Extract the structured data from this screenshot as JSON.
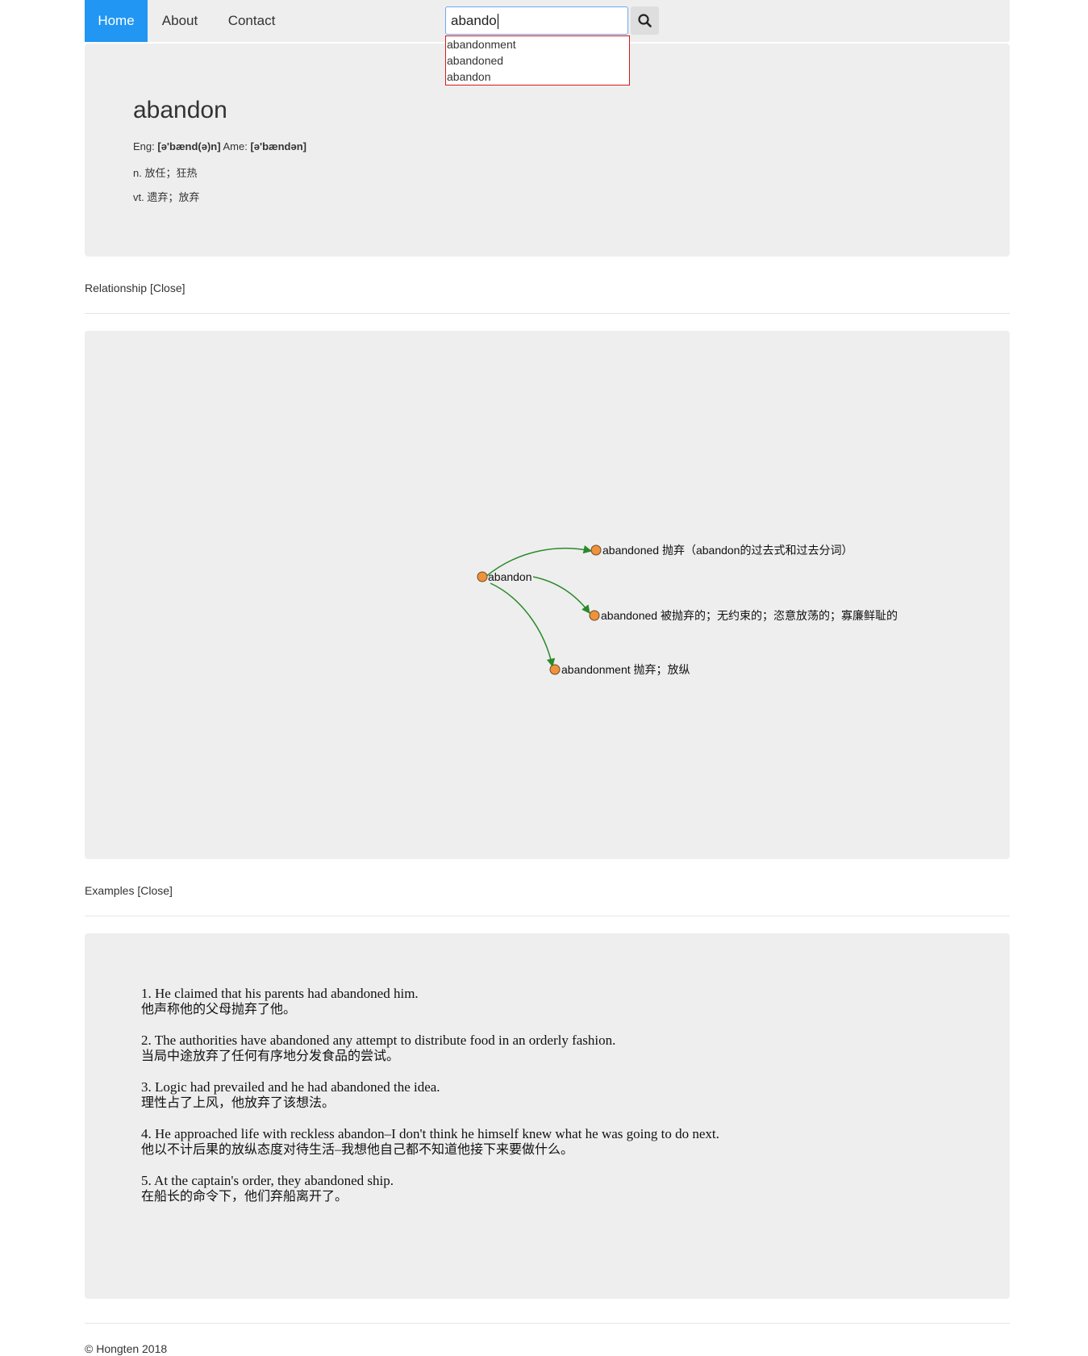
{
  "nav": {
    "home": "Home",
    "about": "About",
    "contact": "Contact"
  },
  "search": {
    "value": "abando",
    "icon": "search-icon",
    "suggestions": [
      "abandonment",
      "abandoned",
      "abandon"
    ]
  },
  "word": {
    "title": "abandon",
    "eng_label": "Eng:",
    "eng_phonetic": "[ə'bænd(ə)n]",
    "ame_label": "Ame:",
    "ame_phonetic": "[ə'bændən]",
    "definitions": [
      "n. 放任；狂热",
      "vt. 遗弃；放弃"
    ]
  },
  "relationship": {
    "heading": "Relationship [Close]",
    "nodes": [
      {
        "label": "abandon"
      },
      {
        "label": "abandoned 抛弃（abandon的过去式和过去分词）"
      },
      {
        "label": "abandoned 被抛弃的；无约束的；恣意放荡的；寡廉鲜耻的"
      },
      {
        "label": "abandonment 抛弃；放纵"
      }
    ],
    "colors": {
      "node": "#f0923a",
      "edge": "#2a8a2a"
    }
  },
  "examples": {
    "heading": "Examples [Close]",
    "items": [
      {
        "en": "1. He claimed that his parents had abandoned him.",
        "zh": "他声称他的父母抛弃了他。"
      },
      {
        "en": "2. The authorities have abandoned any attempt to distribute food in an orderly fashion.",
        "zh": "当局中途放弃了任何有序地分发食品的尝试。"
      },
      {
        "en": "3. Logic had prevailed and he had abandoned the idea.",
        "zh": "理性占了上风，他放弃了该想法。"
      },
      {
        "en": "4. He approached life with reckless abandon–I don't think he himself knew what he was going to do next.",
        "zh": "他以不计后果的放纵态度对待生活–我想他自己都不知道他接下来要做什么。"
      },
      {
        "en": "5. At the captain's order, they abandoned ship.",
        "zh": "在船长的命令下，他们弃船离开了。"
      }
    ]
  },
  "footer": "© Hongten 2018"
}
